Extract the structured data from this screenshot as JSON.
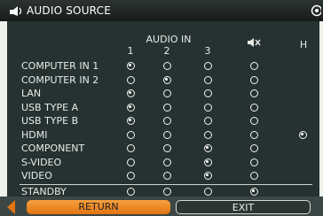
{
  "title": "AUDIO SOURCE",
  "icons": {
    "title": "audio-speaker-icon",
    "corner": "partial-circle-icon"
  },
  "header": {
    "group_label": "AUDIO IN",
    "columns": [
      "1",
      "2",
      "3"
    ],
    "mute_icon": "speaker-mute-icon",
    "h_label": "H"
  },
  "rows": [
    {
      "label": "COMPUTER IN 1",
      "selected_col": 1,
      "h": false
    },
    {
      "label": "COMPUTER IN 2",
      "selected_col": 2,
      "h": false
    },
    {
      "label": "LAN",
      "selected_col": 1,
      "h": false
    },
    {
      "label": "USB TYPE A",
      "selected_col": 1,
      "h": false
    },
    {
      "label": "USB TYPE B",
      "selected_col": 1,
      "h": false
    },
    {
      "label": "HDMI",
      "selected_col": null,
      "h": true
    },
    {
      "label": "COMPONENT",
      "selected_col": 3,
      "h": false
    },
    {
      "label": "S-VIDEO",
      "selected_col": 3,
      "h": false
    },
    {
      "label": "VIDEO",
      "selected_col": 3,
      "h": false
    }
  ],
  "standby": {
    "label": "STANDBY",
    "selected_col": 4
  },
  "buttons": {
    "return": "RETURN",
    "exit": "EXIT"
  },
  "colors": {
    "panel_bg": "#263231",
    "return_accent": "#f08a25",
    "text": "#e9ece6"
  }
}
